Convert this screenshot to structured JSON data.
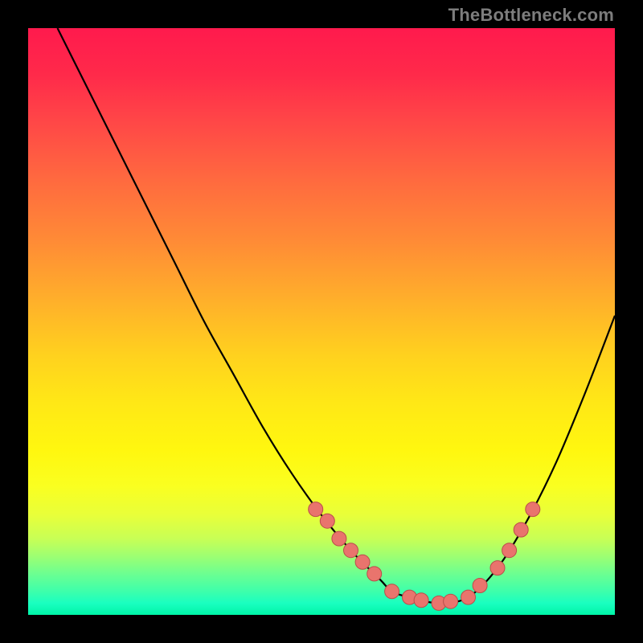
{
  "watermark": "TheBottleneck.com",
  "colors": {
    "curve": "#000000",
    "tolerance_dot_fill": "#e9746d",
    "tolerance_dot_stroke": "#ba4e4a"
  },
  "chart_data": {
    "type": "line",
    "title": "",
    "xlabel": "",
    "ylabel": "",
    "xlim": [
      0,
      100
    ],
    "ylim": [
      0,
      100
    ],
    "grid": false,
    "series": [
      {
        "name": "bottleneck_curve",
        "x": [
          5,
          10,
          15,
          20,
          25,
          30,
          35,
          40,
          45,
          50,
          55,
          60,
          62,
          65,
          70,
          75,
          80,
          85,
          90,
          95,
          100
        ],
        "y": [
          100,
          90,
          80,
          70,
          60,
          50,
          41,
          32,
          24,
          17,
          11,
          6,
          4,
          3,
          2,
          3,
          8,
          16,
          26,
          38,
          51
        ]
      }
    ],
    "tolerance_band": {
      "threshold_percent": 15,
      "dots": [
        {
          "x": 49,
          "y": 18
        },
        {
          "x": 51,
          "y": 16
        },
        {
          "x": 53,
          "y": 13
        },
        {
          "x": 55,
          "y": 11
        },
        {
          "x": 57,
          "y": 9
        },
        {
          "x": 59,
          "y": 7
        },
        {
          "x": 62,
          "y": 4
        },
        {
          "x": 65,
          "y": 3
        },
        {
          "x": 67,
          "y": 2.5
        },
        {
          "x": 70,
          "y": 2
        },
        {
          "x": 72,
          "y": 2.3
        },
        {
          "x": 75,
          "y": 3
        },
        {
          "x": 77,
          "y": 5
        },
        {
          "x": 80,
          "y": 8
        },
        {
          "x": 82,
          "y": 11
        },
        {
          "x": 84,
          "y": 14.5
        },
        {
          "x": 86,
          "y": 18
        }
      ]
    }
  }
}
